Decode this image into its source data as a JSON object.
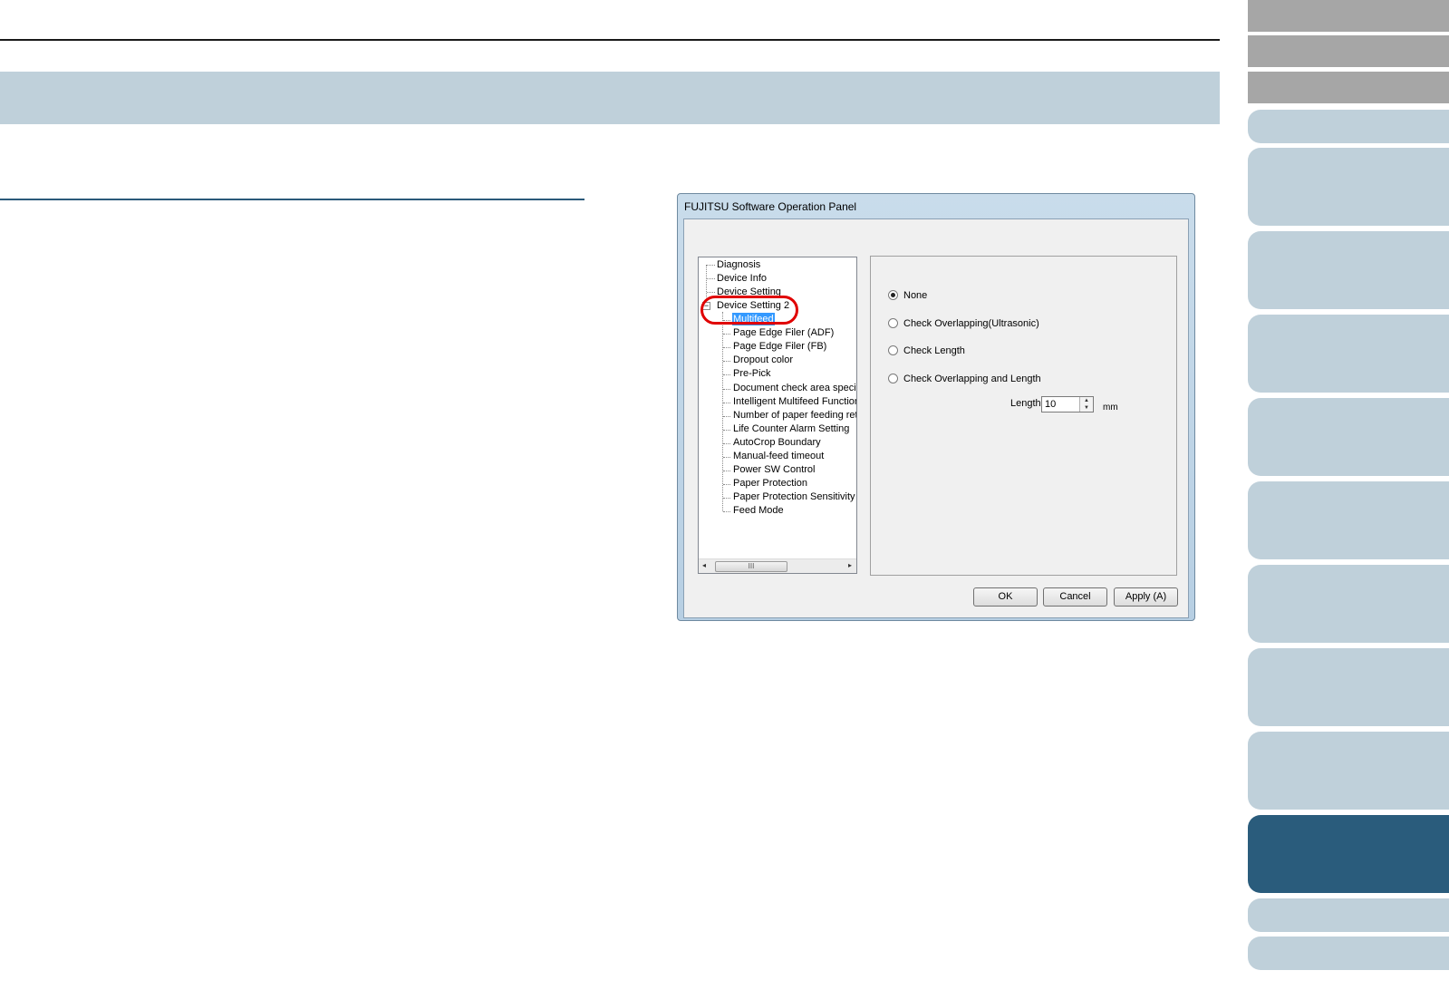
{
  "dialog": {
    "title": "FUJITSU Software Operation Panel",
    "tree": {
      "items": [
        "Diagnosis",
        "Device Info",
        "Device Setting",
        "Device Setting 2",
        "Multifeed",
        "Page Edge Filer (ADF)",
        "Page Edge Filer (FB)",
        "Dropout color",
        "Pre-Pick",
        "Document check area specific",
        "Intelligent Multifeed Function",
        "Number of paper feeding retrie",
        "Life Counter Alarm Setting",
        "AutoCrop Boundary",
        "Manual-feed timeout",
        "Power SW Control",
        "Paper Protection",
        "Paper Protection Sensitivity",
        "Feed Mode"
      ],
      "selected": "Multifeed",
      "expander_symbol": "−",
      "scroll_thumb_grip": "III",
      "scroll_left_icon": "◂",
      "scroll_right_icon": "▸"
    },
    "options": {
      "none": "None",
      "ultrasonic": "Check Overlapping(Ultrasonic)",
      "length": "Check Length",
      "overlap_length": "Check Overlapping and Length",
      "selected": "None"
    },
    "length_field": {
      "label": "Length",
      "value": "10",
      "unit": "mm",
      "spin_up": "▲",
      "spin_down": "▼"
    },
    "buttons": {
      "ok": "OK",
      "cancel": "Cancel",
      "apply": "Apply (A)"
    }
  },
  "colors": {
    "band": "#bfd0da",
    "tab_gray": "#a6a6a6",
    "tab_light": "#bfd0da",
    "tab_active": "#2a5c7c",
    "highlight_ring": "#e00000",
    "selection": "#3399ff"
  }
}
